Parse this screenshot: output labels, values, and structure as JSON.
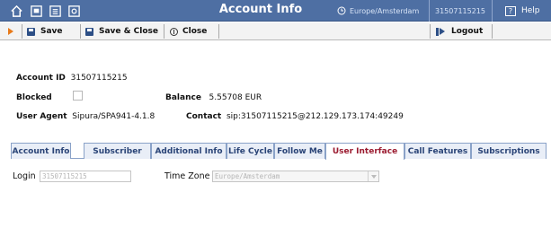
{
  "header": {
    "title": "Account Info",
    "timezone": "Europe/Amsterdam",
    "account_id": "31507115215",
    "help_label": "Help",
    "icons": [
      "home-icon",
      "monitor-icon",
      "grid-icon",
      "at-icon"
    ]
  },
  "toolbar": {
    "save_label": "Save",
    "save_close_label": "Save & Close",
    "close_label": "Close",
    "logout_label": "Logout"
  },
  "info": {
    "account_id_label": "Account ID",
    "account_id_value": "31507115215",
    "blocked_label": "Blocked",
    "blocked_checked": false,
    "balance_label": "Balance",
    "balance_value": "5.55708 EUR",
    "user_agent_label": "User Agent",
    "user_agent_value": "Sipura/SPA941-4.1.8",
    "contact_label": "Contact",
    "contact_value": "sip:31507115215@212.129.173.174:49249"
  },
  "tabs": [
    {
      "label": "Account Info",
      "active": false
    },
    {
      "label": "Subscriber",
      "active": false
    },
    {
      "label": "Additional Info",
      "active": false
    },
    {
      "label": "Life Cycle",
      "active": false
    },
    {
      "label": "Follow Me",
      "active": false
    },
    {
      "label": "User Interface",
      "active": true
    },
    {
      "label": "Call Features",
      "active": false
    },
    {
      "label": "Subscriptions",
      "active": false
    }
  ],
  "form": {
    "login_label": "Login",
    "login_value": "31507115215",
    "timezone_label": "Time Zone",
    "timezone_value": "Europe/Amsterdam"
  },
  "colors": {
    "header_bg": "#4e6fa3",
    "active_tab_text": "#9b1b30",
    "tab_text": "#2a4477",
    "toolbar_arrow": "#e87a1a"
  }
}
